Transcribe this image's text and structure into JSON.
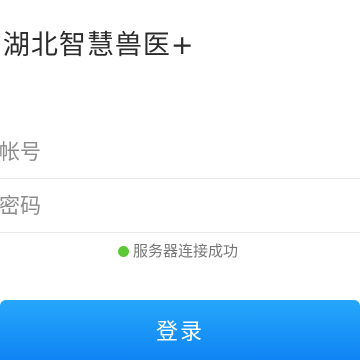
{
  "app": {
    "title": "•湖北智慧兽医+"
  },
  "form": {
    "account_placeholder": "入帐号",
    "account_value": "",
    "password_placeholder": "入密码",
    "password_value": ""
  },
  "status": {
    "text": "服务器连接成功",
    "color": "#5cc836"
  },
  "login": {
    "label": "登录",
    "color_start": "#26a7fb",
    "color_end": "#0f84f4"
  }
}
